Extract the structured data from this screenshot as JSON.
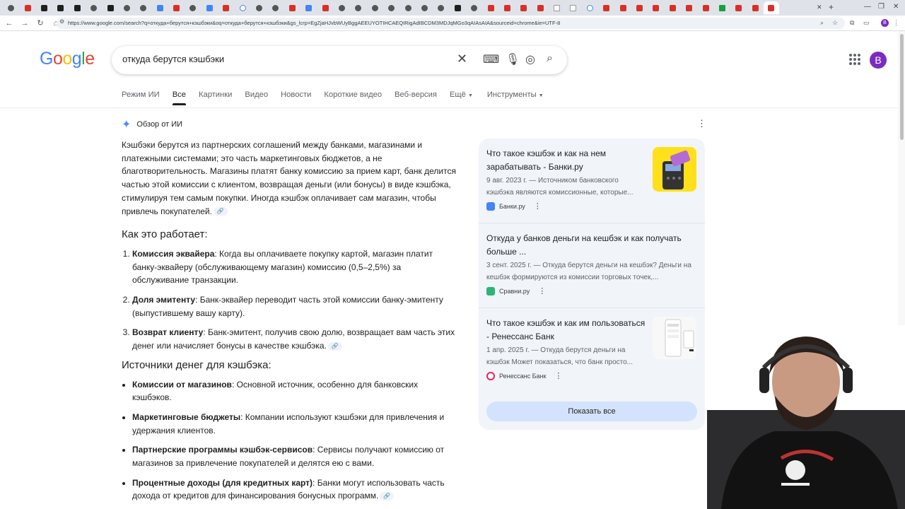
{
  "browser": {
    "url": "https://www.google.com/search?q=откуда+берутся+кэшбэки&oq=откуда+берутся+кэшбэки&gs_lcrp=EgZjaHJvbWUyBggAEEUYOTIHCAEQIRigAdIBCDM3MDJqMGo3qAIAsAIA&sourceid=chrome&ie=UTF-8",
    "profile_initial": "B"
  },
  "google": {
    "logo": "Google",
    "query": "откуда берутся кэшбэки",
    "tabs": [
      "Режим ИИ",
      "Все",
      "Картинки",
      "Видео",
      "Новости",
      "Короткие видео",
      "Веб-версия",
      "Ещё",
      "Инструменты"
    ],
    "avatar_initial": "B"
  },
  "ai_overview": {
    "label": "Обзор от ИИ",
    "intro": "Кэшбэки берутся из партнерских соглашений между банками, магазинами и платежными системами; это часть маркетинговых бюджетов, а не благотворительность. Магазины платят банку комиссию за прием карт, банк делится частью этой комиссии с клиентом, возвращая деньги (или бонусы) в виде кэшбэка, стимулируя тем самым покупки. Иногда кэшбэк оплачивает сам магазин, чтобы привлечь покупателей.",
    "how_heading": "Как это работает:",
    "steps": [
      {
        "bold": "Комиссия эквайера",
        "text": ": Когда вы оплачиваете покупку картой, магазин платит банку-эквайеру (обслуживающему магазин) комиссию (0,5–2,5%) за обслуживание транзакции."
      },
      {
        "bold": "Доля эмитенту",
        "text": ": Банк-эквайер переводит часть этой комиссии банку-эмитенту (выпустившему вашу карту)."
      },
      {
        "bold": "Возврат клиенту",
        "text": ": Банк-эмитент, получив свою долю, возвращает вам часть этих денег или начисляет бонусы в качестве кэшбэка."
      }
    ],
    "sources_heading": "Источники денег для кэшбэка:",
    "sources": [
      {
        "bold": "Комиссии от магазинов",
        "text": ": Основной источник, особенно для банковских кэшбэков."
      },
      {
        "bold": "Маркетинговые бюджеты",
        "text": ": Компании используют кэшбэки для привлечения и удержания клиентов."
      },
      {
        "bold": "Партнерские программы кэшбэк-сервисов",
        "text": ": Сервисы получают комиссию от магазинов за привлечение покупателей и делятся ею с вами."
      },
      {
        "bold": "Процентные доходы (для кредитных карт)",
        "text": ": Банки могут использовать часть дохода от кредитов для финансирования бонусных программ."
      }
    ]
  },
  "sidebar": {
    "cards": [
      {
        "title": "Что такое кэшбэк и как на нем зарабатывать - Банки.ру",
        "snippet": "9 авг. 2023 г. — Источником банковского кэшбэка являются комиссионные, которые...",
        "source": "Банки.ру",
        "color": "#4285f4"
      },
      {
        "title": "Откуда у банков деньги на кешбэк и как получать больше ...",
        "snippet": "3 сент. 2025 г. — Откуда берутся деньги на кешбэк? Деньги на кешбэк формируются из комиссии торговых точек,...",
        "source": "Сравни.ру",
        "color": "#2bb673"
      },
      {
        "title": "Что такое кэшбэк и как им пользоваться - Ренессанс Банк",
        "snippet": "1 апр. 2025 г. — Откуда берутся деньги на кэшбэк Может показаться, что банк просто...",
        "source": "Ренессанс Банк",
        "color": "#e0245e"
      }
    ],
    "show_all": "Показать все"
  }
}
